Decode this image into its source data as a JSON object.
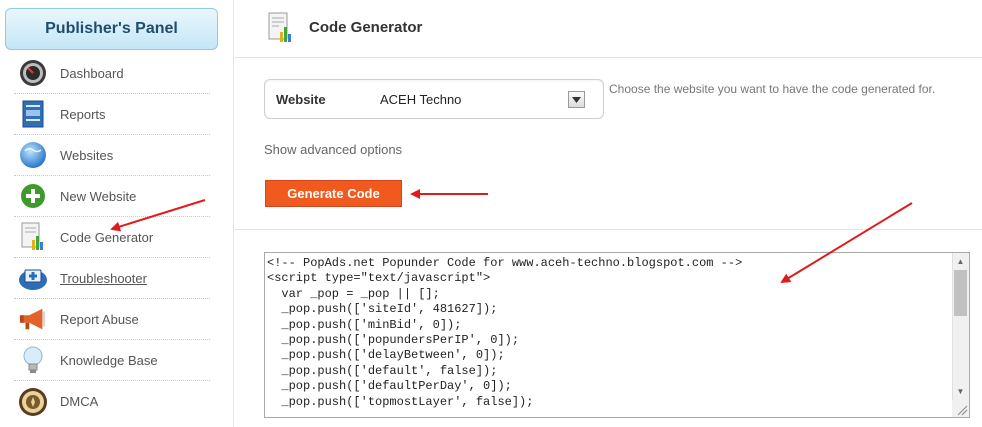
{
  "sidebar": {
    "panel_title": "Publisher's Panel",
    "items": [
      {
        "label": "Dashboard",
        "icon": "dashboard-icon"
      },
      {
        "label": "Reports",
        "icon": "reports-icon"
      },
      {
        "label": "Websites",
        "icon": "globe-icon"
      },
      {
        "label": "New Website",
        "icon": "plus-icon"
      },
      {
        "label": "Code Generator",
        "icon": "chart-document-icon"
      },
      {
        "label": "Troubleshooter",
        "icon": "monitor-plus-icon"
      },
      {
        "label": "Report Abuse",
        "icon": "megaphone-icon"
      },
      {
        "label": "Knowledge Base",
        "icon": "lightbulb-icon"
      },
      {
        "label": "DMCA",
        "icon": "seal-icon"
      }
    ]
  },
  "header": {
    "title": "Code Generator",
    "icon": "chart-document-icon"
  },
  "form": {
    "website_label": "Website",
    "website_value": "ACEH Techno",
    "website_hint": "Choose the website you want to have the code generated for.",
    "advanced_link": "Show advanced options",
    "generate_button": "Generate Code"
  },
  "code": {
    "lines": [
      "<!-- PopAds.net Popunder Code for www.aceh-techno.blogspot.com -->",
      "<script type=\"text/javascript\">",
      "  var _pop = _pop || [];",
      "  _pop.push(['siteId', 481627]);",
      "  _pop.push(['minBid', 0]);",
      "  _pop.push(['popundersPerIP', 0]);",
      "  _pop.push(['delayBetween', 0]);",
      "  _pop.push(['default', false]);",
      "  _pop.push(['defaultPerDay', 0]);",
      "  _pop.push(['topmostLayer', false]);"
    ]
  },
  "colors": {
    "accent": "#f15a1f",
    "annotation_arrow": "#e01b1b",
    "panel_border": "#8fcbe6"
  }
}
